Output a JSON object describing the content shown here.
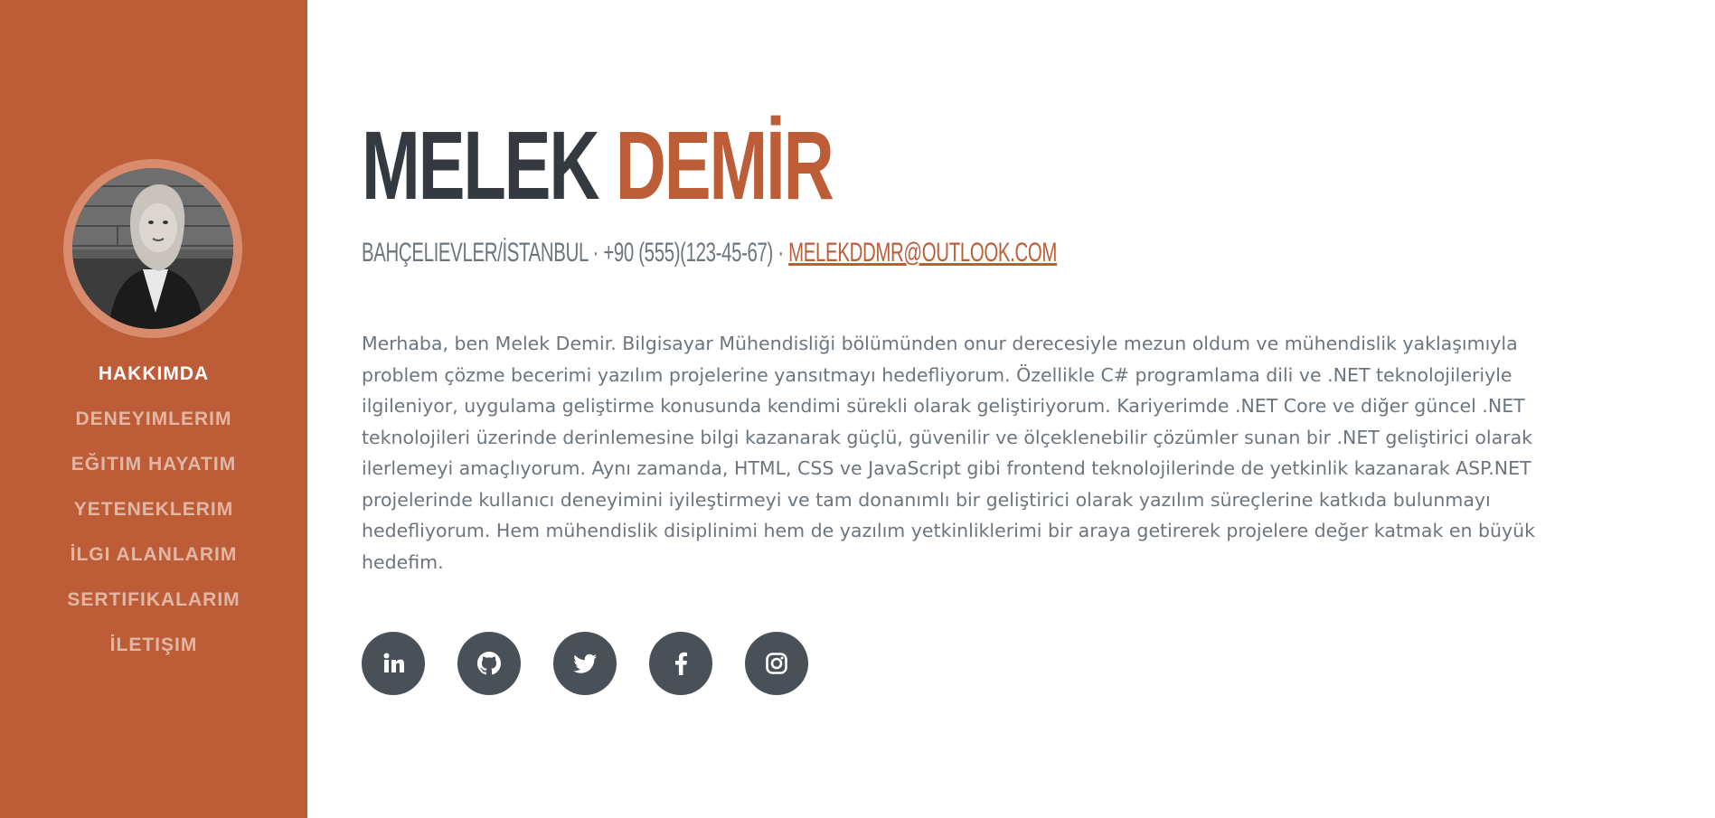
{
  "sidebar": {
    "nav": [
      {
        "label": "HAKKIMDA",
        "active": true
      },
      {
        "label": "DENEYIMLERIM",
        "active": false
      },
      {
        "label": "EĞITIM HAYATIM",
        "active": false
      },
      {
        "label": "YETENEKLERIM",
        "active": false
      },
      {
        "label": "İLGI ALANLARIM",
        "active": false
      },
      {
        "label": "SERTIFIKALARIM",
        "active": false
      },
      {
        "label": "İLETIŞIM",
        "active": false
      }
    ]
  },
  "header": {
    "first_name": "MELEK",
    "last_name": "DEMİR",
    "location_phone": "BAHÇELIEVLER/İSTANBUL · +90 (555)(123-45-67) · ",
    "email": "MELEKDDMR@OUTLOOK.COM"
  },
  "about": {
    "text": "Merhaba, ben Melek Demir. Bilgisayar Mühendisliği bölümünden onur derecesiyle mezun oldum ve mühendislik yaklaşımıyla problem çözme becerimi yazılım projelerine yansıtmayı hedefliyorum. Özellikle C# programlama dili ve .NET teknolojileriyle ilgileniyor, uygulama geliştirme konusunda kendimi sürekli olarak geliştiriyorum. Kariyerimde .NET Core ve diğer güncel .NET teknolojileri üzerinde derinlemesine bilgi kazanarak güçlü, güvenilir ve ölçeklenebilir çözümler sunan bir .NET geliştirici olarak ilerlemeyi amaçlıyorum. Aynı zamanda, HTML, CSS ve JavaScript gibi frontend teknolojilerinde de yetkinlik kazanarak ASP.NET projelerinde kullanıcı deneyimini iyileştirmeyi ve tam donanımlı bir geliştirici olarak yazılım süreçlerine katkıda bulunmayı hedefliyorum. Hem mühendislik disiplinimi hem de yazılım yetkinliklerimi bir araya getirerek projelere değer katmak en büyük hedefim."
  },
  "socials": [
    {
      "icon": "linkedin-icon"
    },
    {
      "icon": "github-icon"
    },
    {
      "icon": "twitter-icon"
    },
    {
      "icon": "facebook-icon"
    },
    {
      "icon": "instagram-icon"
    }
  ],
  "colors": {
    "primary": "#bd5d38",
    "dark": "#343a40",
    "muted": "#6c757d",
    "social_bg": "#495057"
  }
}
